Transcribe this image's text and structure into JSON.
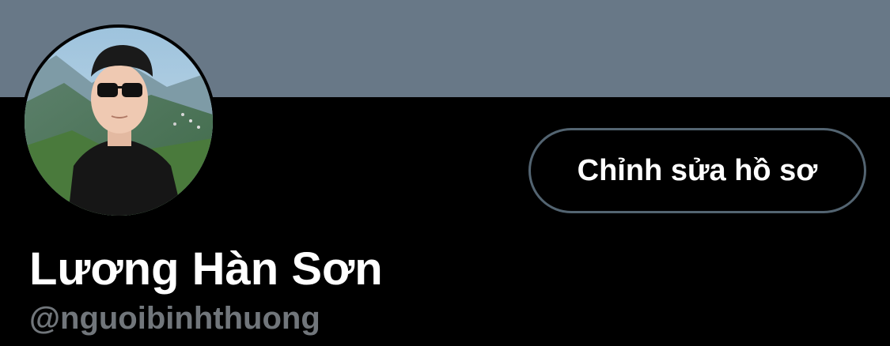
{
  "profile": {
    "display_name": "Lương Hàn Sơn",
    "handle": "@nguoibinhthuong",
    "edit_button_label": "Chỉnh sửa hồ sơ"
  },
  "colors": {
    "banner": "#687887",
    "background": "#000000",
    "button_border": "#536471",
    "handle_text": "#71767b"
  }
}
